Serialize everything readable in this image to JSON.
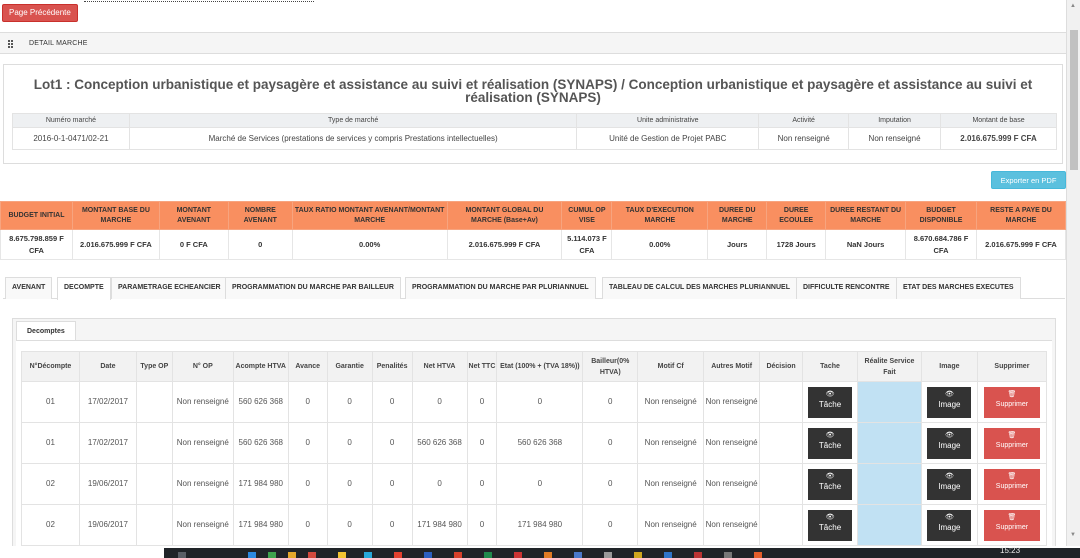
{
  "topbar": {
    "back_label": "Page Précédente"
  },
  "panel": {
    "title": "DETAIL MARCHE"
  },
  "lot": {
    "title": "Lot1 : Conception urbanistique et paysagère et assistance au suivi et réalisation (SYNAPS) / Conception urbanistique et paysagère et assistance au suivi et réalisation (SYNAPS)",
    "headers": [
      "Numéro marché",
      "Type de marché",
      "Unite administrative",
      "Activité",
      "Imputation",
      "Montant de base"
    ],
    "row": {
      "numero": "2016-0-1-0471/02-21",
      "type": "Marché de Services (prestations de services y compris Prestations intellectuelles)",
      "unite": "Unité de Gestion de Projet PABC",
      "activite": "Non renseigné",
      "imputation": "Non renseigné",
      "montant": "2.016.675.999 F CFA"
    }
  },
  "export_label": "Exporter en PDF",
  "budget": {
    "headers": [
      "BUDGET INITIAL",
      "MONTANT BASE DU MARCHE",
      "MONTANT AVENANT",
      "NOMBRE AVENANT",
      "TAUX RATIO MONTANT AVENANT/MONTANT MARCHE",
      "MONTANT GLOBAL DU MARCHE (Base+Av)",
      "CUMUL OP VISE",
      "TAUX D'EXECUTION MARCHE",
      "DUREE DU MARCHE",
      "DUREE ECOULEE",
      "DUREE RESTANT DU MARCHE",
      "BUDGET DISPONIBLE",
      "RESTE A PAYE DU MARCHE"
    ],
    "values": [
      "8.675.798.859 F CFA",
      "2.016.675.999 F CFA",
      "0 F CFA",
      "0",
      "0.00%",
      "2.016.675.999 F CFA",
      "5.114.073 F CFA",
      "0.00%",
      "Jours",
      "1728 Jours",
      "NaN Jours",
      "8.670.684.786 F CFA",
      "2.016.675.999 F CFA"
    ]
  },
  "tabs": [
    "AVENANT",
    "DECOMPTE",
    "PARAMETRAGE ECHEANCIER",
    "PROGRAMMATION DU MARCHE PAR BAILLEUR",
    "PROGRAMMATION DU MARCHE PAR PLURIANNUEL",
    "TABLEAU DE CALCUL DES MARCHES PLURIANNUEL",
    "DIFFICULTE RENCONTRE",
    "ETAT DES MARCHES EXECUTES"
  ],
  "decomptes": {
    "sub_tab": "Decomptes",
    "headers": [
      "N°Décompte",
      "Date",
      "Type OP",
      "N° OP",
      "Acompte HTVA",
      "Avance",
      "Garantie",
      "Penalités",
      "Net HTVA",
      "Net TTC",
      "Etat (100% + (TVA 18%))",
      "Bailleur(0% HTVA)",
      "Motif Cf",
      "Autres Motif",
      "Décision",
      "Tache",
      "Réalite Service Fait",
      "Image",
      "Supprimer"
    ],
    "action_labels": {
      "tache": "Tâche",
      "image": "Image",
      "supprimer": "Supprimer"
    },
    "rows": [
      {
        "num": "01",
        "date": "17/02/2017",
        "type_op": "",
        "num_op": "Non renseigné",
        "acompte": "560 626 368",
        "avance": "0",
        "garantie": "0",
        "penalites": "0",
        "net_htva": "0",
        "net_ttc": "0",
        "etat": "0",
        "bailleur": "0",
        "motif_cf": "Non renseigné",
        "autres": "Non renseigné",
        "decision": ""
      },
      {
        "num": "01",
        "date": "17/02/2017",
        "type_op": "",
        "num_op": "Non renseigné",
        "acompte": "560 626 368",
        "avance": "0",
        "garantie": "0",
        "penalites": "0",
        "net_htva": "560 626 368",
        "net_ttc": "0",
        "etat": "560 626 368",
        "bailleur": "0",
        "motif_cf": "Non renseigné",
        "autres": "Non renseigné",
        "decision": ""
      },
      {
        "num": "02",
        "date": "19/06/2017",
        "type_op": "",
        "num_op": "Non renseigné",
        "acompte": "171 984 980",
        "avance": "0",
        "garantie": "0",
        "penalites": "0",
        "net_htva": "0",
        "net_ttc": "0",
        "etat": "0",
        "bailleur": "0",
        "motif_cf": "Non renseigné",
        "autres": "Non renseigné",
        "decision": ""
      },
      {
        "num": "02",
        "date": "19/06/2017",
        "type_op": "",
        "num_op": "Non renseigné",
        "acompte": "171 984 980",
        "avance": "0",
        "garantie": "0",
        "penalites": "0",
        "net_htva": "171 984 980",
        "net_ttc": "0",
        "etat": "171 984 980",
        "bailleur": "0",
        "motif_cf": "Non renseigné",
        "autres": "Non renseigné",
        "decision": ""
      }
    ]
  },
  "taskbar": {
    "clock": "15:23"
  },
  "colors": {
    "accent_red": "#d9534f",
    "budget_header": "#f98f60",
    "export_blue": "#5bc0de",
    "realise_blue": "#c1e1f3"
  }
}
